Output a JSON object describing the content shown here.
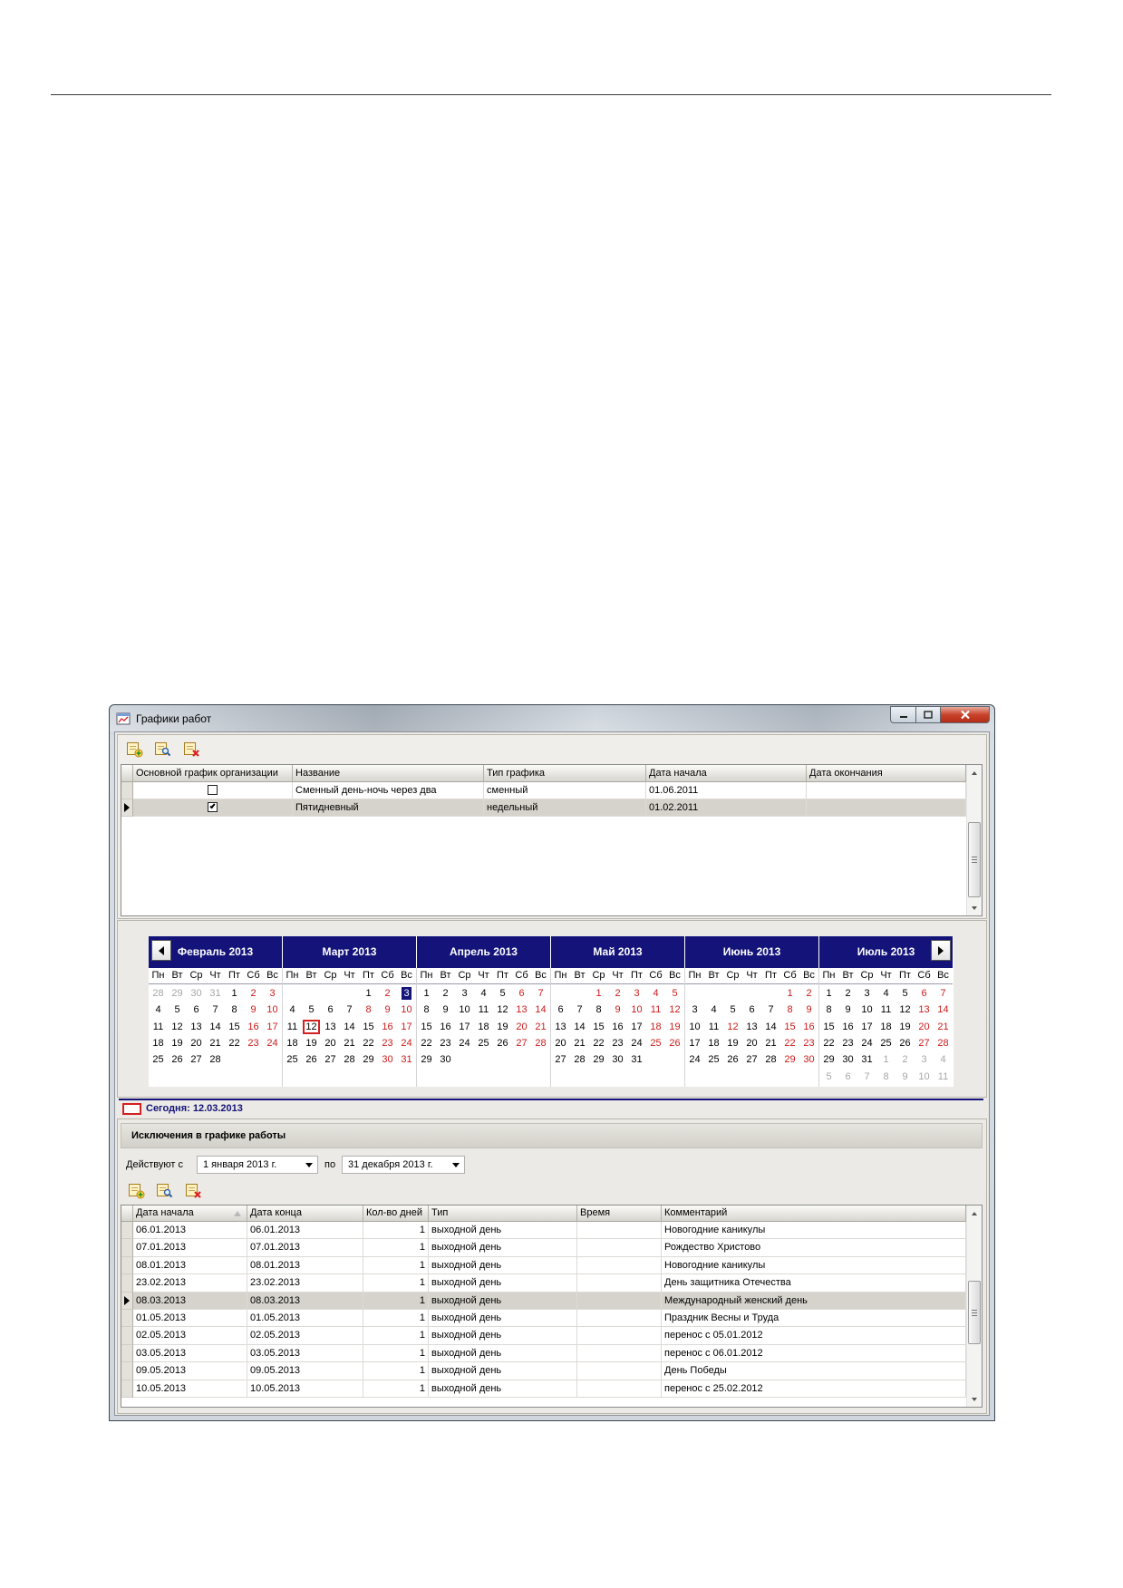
{
  "window": {
    "title": "Графики работ",
    "icon": "schedule-window-icon",
    "controls": [
      "minimize-icon",
      "maximize-icon",
      "close-icon"
    ]
  },
  "toolbar": {
    "icons": [
      "add-record-icon",
      "edit-record-icon",
      "delete-record-icon"
    ]
  },
  "schedules": {
    "columns": [
      "Основной график организации",
      "Название",
      "Тип графика",
      "Дата начала",
      "Дата окончания"
    ],
    "rows": [
      {
        "main": false,
        "name": "Сменный день-ночь через два",
        "type": "сменный",
        "start": "01.06.2011",
        "end": "",
        "selected": false
      },
      {
        "main": true,
        "name": "Пятидневный",
        "type": "недельный",
        "start": "01.02.2011",
        "end": "",
        "selected": true
      }
    ]
  },
  "calendar": {
    "day_names": [
      "Пн",
      "Вт",
      "Ср",
      "Чт",
      "Пт",
      "Сб",
      "Вс"
    ],
    "months": [
      {
        "name": "Февраль 2013",
        "weeks": [
          [
            {
              "d": "28",
              "k": "o"
            },
            {
              "d": "29",
              "k": "o"
            },
            {
              "d": "30",
              "k": "o"
            },
            {
              "d": "31",
              "k": "o"
            },
            "1",
            {
              "d": "2",
              "k": "r"
            },
            {
              "d": "3",
              "k": "r"
            }
          ],
          [
            "4",
            "5",
            "6",
            "7",
            "8",
            {
              "d": "9",
              "k": "r"
            },
            {
              "d": "10",
              "k": "r"
            }
          ],
          [
            "11",
            "12",
            "13",
            "14",
            "15",
            {
              "d": "16",
              "k": "r"
            },
            {
              "d": "17",
              "k": "r"
            }
          ],
          [
            "18",
            "19",
            "20",
            "21",
            "22",
            {
              "d": "23",
              "k": "r"
            },
            {
              "d": "24",
              "k": "r"
            }
          ],
          [
            "25",
            "26",
            "27",
            "28",
            "",
            "",
            ""
          ]
        ]
      },
      {
        "name": "Март 2013",
        "weeks": [
          [
            "",
            "",
            "",
            "",
            "1",
            {
              "d": "2",
              "k": "r"
            },
            {
              "d": "3",
              "k": "sel"
            }
          ],
          [
            "4",
            "5",
            "6",
            "7",
            {
              "d": "8",
              "k": "r"
            },
            {
              "d": "9",
              "k": "r"
            },
            {
              "d": "10",
              "k": "r"
            }
          ],
          [
            "11",
            {
              "d": "12",
              "k": "today"
            },
            "13",
            "14",
            "15",
            {
              "d": "16",
              "k": "r"
            },
            {
              "d": "17",
              "k": "r"
            }
          ],
          [
            "18",
            "19",
            "20",
            "21",
            "22",
            {
              "d": "23",
              "k": "r"
            },
            {
              "d": "24",
              "k": "r"
            }
          ],
          [
            "25",
            "26",
            "27",
            "28",
            "29",
            {
              "d": "30",
              "k": "r"
            },
            {
              "d": "31",
              "k": "r"
            }
          ]
        ]
      },
      {
        "name": "Апрель 2013",
        "weeks": [
          [
            "1",
            "2",
            "3",
            "4",
            "5",
            {
              "d": "6",
              "k": "r"
            },
            {
              "d": "7",
              "k": "r"
            }
          ],
          [
            "8",
            "9",
            "10",
            "11",
            "12",
            {
              "d": "13",
              "k": "r"
            },
            {
              "d": "14",
              "k": "r"
            }
          ],
          [
            "15",
            "16",
            "17",
            "18",
            "19",
            {
              "d": "20",
              "k": "r"
            },
            {
              "d": "21",
              "k": "r"
            }
          ],
          [
            "22",
            "23",
            "24",
            "25",
            "26",
            {
              "d": "27",
              "k": "r"
            },
            {
              "d": "28",
              "k": "r"
            }
          ],
          [
            "29",
            "30",
            "",
            "",
            "",
            "",
            ""
          ]
        ]
      },
      {
        "name": "Май 2013",
        "weeks": [
          [
            "",
            "",
            {
              "d": "1",
              "k": "r"
            },
            {
              "d": "2",
              "k": "r"
            },
            {
              "d": "3",
              "k": "r"
            },
            {
              "d": "4",
              "k": "r"
            },
            {
              "d": "5",
              "k": "r"
            }
          ],
          [
            "6",
            "7",
            "8",
            {
              "d": "9",
              "k": "r"
            },
            {
              "d": "10",
              "k": "r"
            },
            {
              "d": "11",
              "k": "r"
            },
            {
              "d": "12",
              "k": "r"
            }
          ],
          [
            "13",
            "14",
            "15",
            "16",
            "17",
            {
              "d": "18",
              "k": "r"
            },
            {
              "d": "19",
              "k": "r"
            }
          ],
          [
            "20",
            "21",
            "22",
            "23",
            "24",
            {
              "d": "25",
              "k": "r"
            },
            {
              "d": "26",
              "k": "r"
            }
          ],
          [
            "27",
            "28",
            "29",
            "30",
            "31",
            "",
            ""
          ]
        ]
      },
      {
        "name": "Июнь 2013",
        "weeks": [
          [
            "",
            "",
            "",
            "",
            "",
            {
              "d": "1",
              "k": "r"
            },
            {
              "d": "2",
              "k": "r"
            }
          ],
          [
            "3",
            "4",
            "5",
            "6",
            "7",
            {
              "d": "8",
              "k": "r"
            },
            {
              "d": "9",
              "k": "r"
            }
          ],
          [
            "10",
            "11",
            {
              "d": "12",
              "k": "r"
            },
            "13",
            "14",
            {
              "d": "15",
              "k": "r"
            },
            {
              "d": "16",
              "k": "r"
            }
          ],
          [
            "17",
            "18",
            "19",
            "20",
            "21",
            {
              "d": "22",
              "k": "r"
            },
            {
              "d": "23",
              "k": "r"
            }
          ],
          [
            "24",
            "25",
            "26",
            "27",
            "28",
            {
              "d": "29",
              "k": "r"
            },
            {
              "d": "30",
              "k": "r"
            }
          ]
        ]
      },
      {
        "name": "Июль 2013",
        "weeks": [
          [
            "1",
            "2",
            "3",
            "4",
            "5",
            {
              "d": "6",
              "k": "r"
            },
            {
              "d": "7",
              "k": "r"
            }
          ],
          [
            "8",
            "9",
            "10",
            "11",
            "12",
            {
              "d": "13",
              "k": "r"
            },
            {
              "d": "14",
              "k": "r"
            }
          ],
          [
            "15",
            "16",
            "17",
            "18",
            "19",
            {
              "d": "20",
              "k": "r"
            },
            {
              "d": "21",
              "k": "r"
            }
          ],
          [
            "22",
            "23",
            "24",
            "25",
            "26",
            {
              "d": "27",
              "k": "r"
            },
            {
              "d": "28",
              "k": "r"
            }
          ],
          [
            "29",
            "30",
            "31",
            {
              "d": "1",
              "k": "o"
            },
            {
              "d": "2",
              "k": "o"
            },
            {
              "d": "3",
              "k": "o"
            },
            {
              "d": "4",
              "k": "o"
            }
          ],
          [
            {
              "d": "5",
              "k": "o"
            },
            {
              "d": "6",
              "k": "o"
            },
            {
              "d": "7",
              "k": "o"
            },
            {
              "d": "8",
              "k": "o"
            },
            {
              "d": "9",
              "k": "o"
            },
            {
              "d": "10",
              "k": "o"
            },
            {
              "d": "11",
              "k": "o"
            }
          ]
        ]
      }
    ],
    "today_label": "Сегодня: 12.03.2013"
  },
  "exceptions": {
    "title": "Исключения в графике работы",
    "filter": {
      "from_label": "Действуют с",
      "from_value": "1 января 2013 г.",
      "to_label": "по",
      "to_value": "31 декабря 2013 г."
    },
    "columns": [
      "Дата начала",
      "Дата конца",
      "Кол-во дней",
      "Тип",
      "Время",
      "Комментарий"
    ],
    "rows": [
      {
        "start": "06.01.2013",
        "end": "06.01.2013",
        "days": "1",
        "type": "выходной день",
        "time": "",
        "comment": "Новогодние каникулы",
        "selected": false
      },
      {
        "start": "07.01.2013",
        "end": "07.01.2013",
        "days": "1",
        "type": "выходной день",
        "time": "",
        "comment": "Рождество Христово",
        "selected": false
      },
      {
        "start": "08.01.2013",
        "end": "08.01.2013",
        "days": "1",
        "type": "выходной день",
        "time": "",
        "comment": "Новогодние каникулы",
        "selected": false
      },
      {
        "start": "23.02.2013",
        "end": "23.02.2013",
        "days": "1",
        "type": "выходной день",
        "time": "",
        "comment": "День защитника Отечества",
        "selected": false
      },
      {
        "start": "08.03.2013",
        "end": "08.03.2013",
        "days": "1",
        "type": "выходной день",
        "time": "",
        "comment": "Международный женский день",
        "selected": true
      },
      {
        "start": "01.05.2013",
        "end": "01.05.2013",
        "days": "1",
        "type": "выходной день",
        "time": "",
        "comment": "Праздник Весны и Труда",
        "selected": false
      },
      {
        "start": "02.05.2013",
        "end": "02.05.2013",
        "days": "1",
        "type": "выходной день",
        "time": "",
        "comment": "перенос с 05.01.2012",
        "selected": false
      },
      {
        "start": "03.05.2013",
        "end": "03.05.2013",
        "days": "1",
        "type": "выходной день",
        "time": "",
        "comment": "перенос с 06.01.2012",
        "selected": false
      },
      {
        "start": "09.05.2013",
        "end": "09.05.2013",
        "days": "1",
        "type": "выходной день",
        "time": "",
        "comment": "День Победы",
        "selected": false
      },
      {
        "start": "10.05.2013",
        "end": "10.05.2013",
        "days": "1",
        "type": "выходной день",
        "time": "",
        "comment": "перенос с 25.02.2012",
        "selected": false
      }
    ]
  },
  "colors": {
    "calendar_header": "#13137a",
    "weekend": "#cc1a1a",
    "other_month": "#a6a6a6",
    "today_marker": "#d42020",
    "selected_row": "#d6d3cc"
  }
}
